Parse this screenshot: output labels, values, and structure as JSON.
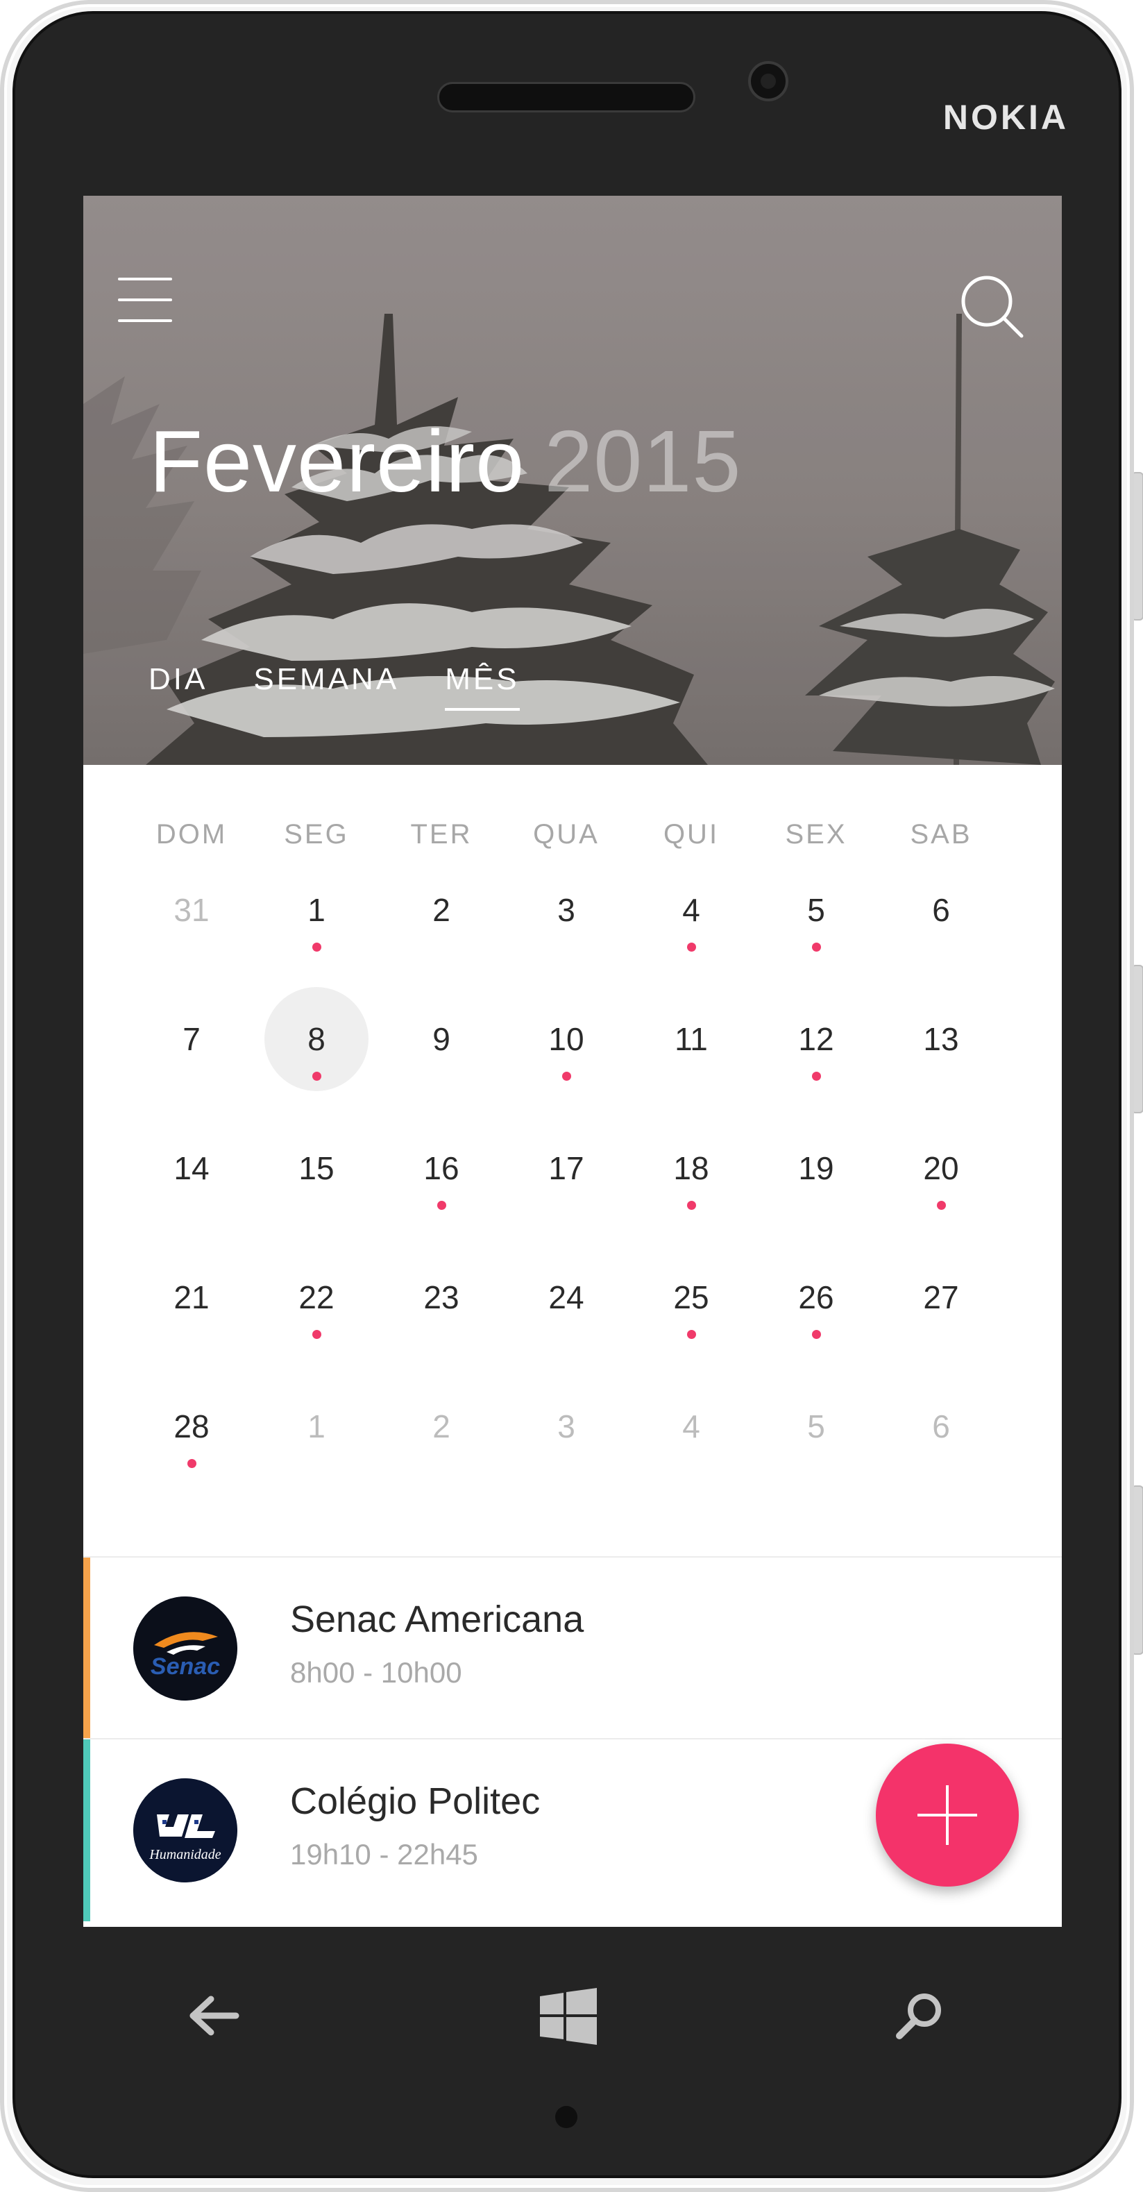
{
  "device": {
    "brand": "NOKIA"
  },
  "header": {
    "month": "Fevereiro",
    "year": "2015",
    "tabs": [
      {
        "label": "DIA",
        "active": false
      },
      {
        "label": "SEMANA",
        "active": false
      },
      {
        "label": "MÊS",
        "active": true
      }
    ]
  },
  "calendar": {
    "weekdays": [
      "DOM",
      "SEG",
      "TER",
      "QUA",
      "QUI",
      "SEX",
      "SAB"
    ],
    "weeks": [
      [
        {
          "d": "31",
          "muted": true,
          "event": false
        },
        {
          "d": "1",
          "muted": false,
          "event": true
        },
        {
          "d": "2",
          "muted": false,
          "event": false
        },
        {
          "d": "3",
          "muted": false,
          "event": false
        },
        {
          "d": "4",
          "muted": false,
          "event": true
        },
        {
          "d": "5",
          "muted": false,
          "event": true
        },
        {
          "d": "6",
          "muted": false,
          "event": false
        }
      ],
      [
        {
          "d": "7",
          "muted": false,
          "event": false
        },
        {
          "d": "8",
          "muted": false,
          "event": true,
          "selected": true
        },
        {
          "d": "9",
          "muted": false,
          "event": false
        },
        {
          "d": "10",
          "muted": false,
          "event": true
        },
        {
          "d": "11",
          "muted": false,
          "event": false
        },
        {
          "d": "12",
          "muted": false,
          "event": true
        },
        {
          "d": "13",
          "muted": false,
          "event": false
        }
      ],
      [
        {
          "d": "14",
          "muted": false,
          "event": false
        },
        {
          "d": "15",
          "muted": false,
          "event": false
        },
        {
          "d": "16",
          "muted": false,
          "event": true
        },
        {
          "d": "17",
          "muted": false,
          "event": false
        },
        {
          "d": "18",
          "muted": false,
          "event": true
        },
        {
          "d": "19",
          "muted": false,
          "event": false
        },
        {
          "d": "20",
          "muted": false,
          "event": true
        }
      ],
      [
        {
          "d": "21",
          "muted": false,
          "event": false
        },
        {
          "d": "22",
          "muted": false,
          "event": true
        },
        {
          "d": "23",
          "muted": false,
          "event": false
        },
        {
          "d": "24",
          "muted": false,
          "event": false
        },
        {
          "d": "25",
          "muted": false,
          "event": true
        },
        {
          "d": "26",
          "muted": false,
          "event": true
        },
        {
          "d": "27",
          "muted": false,
          "event": false
        }
      ],
      [
        {
          "d": "28",
          "muted": false,
          "event": true
        },
        {
          "d": "1",
          "muted": true,
          "event": false
        },
        {
          "d": "2",
          "muted": true,
          "event": false
        },
        {
          "d": "3",
          "muted": true,
          "event": false
        },
        {
          "d": "4",
          "muted": true,
          "event": false
        },
        {
          "d": "5",
          "muted": true,
          "event": false
        },
        {
          "d": "6",
          "muted": true,
          "event": false
        }
      ]
    ]
  },
  "events": [
    {
      "title": "Senac Americana",
      "time": "8h00 - 10h00",
      "color": "#f5a34b",
      "logo_text": "Senac"
    },
    {
      "title": "Colégio Politec",
      "time": "19h10 - 22h45",
      "color": "#4fc9b9",
      "logo_text": "Humanidade"
    }
  ],
  "colors": {
    "accent": "#f4336a",
    "event_dot": "#f03a6a"
  },
  "icons": {
    "menu": "hamburger-icon",
    "search": "search-icon",
    "add": "plus-icon",
    "back": "arrow-left-icon",
    "start": "windows-icon",
    "phone_search": "search-icon"
  }
}
